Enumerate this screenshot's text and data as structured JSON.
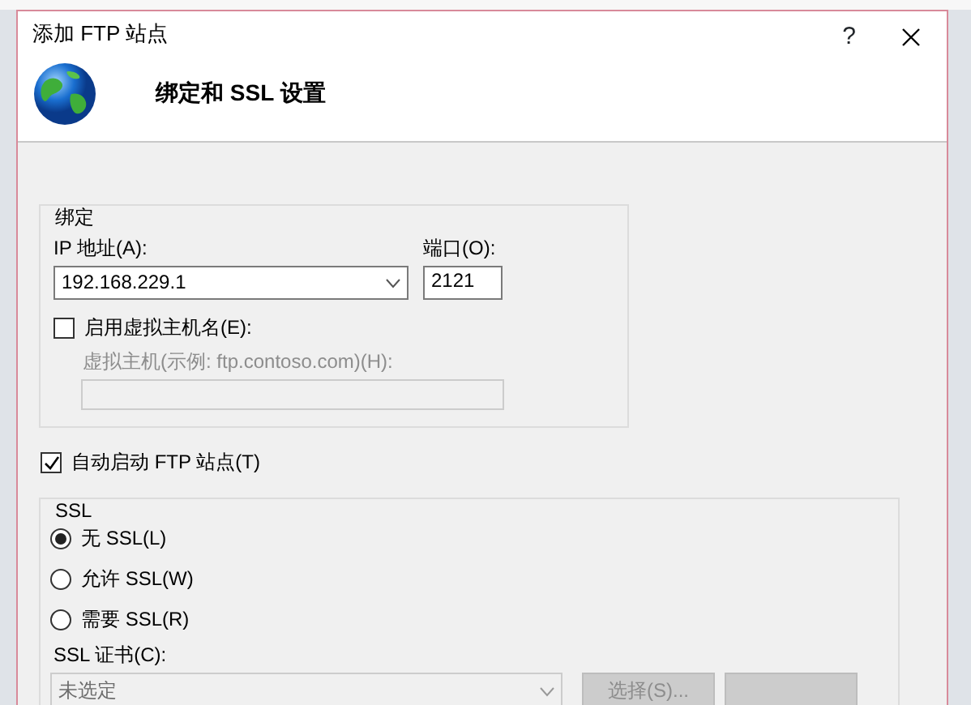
{
  "dialog": {
    "title": "添加 FTP 站点",
    "help": "?",
    "header": "绑定和 SSL 设置"
  },
  "binding": {
    "legend": "绑定",
    "ip_label": "IP 地址(A):",
    "ip_value": "192.168.229.1",
    "port_label": "端口(O):",
    "port_value": "2121",
    "virtual_host": {
      "label": "启用虚拟主机名(E):",
      "checked": false
    },
    "host_label": "虚拟主机(示例: ftp.contoso.com)(H):",
    "host_disabled": true
  },
  "auto_start": {
    "label": "自动启动 FTP 站点(T)",
    "checked": true
  },
  "ssl": {
    "legend": "SSL",
    "options": [
      {
        "label": "无 SSL(L)",
        "selected": true
      },
      {
        "label": "允许 SSL(W)",
        "selected": false
      },
      {
        "label": "需要 SSL(R)",
        "selected": false
      }
    ],
    "cert_label": "SSL 证书(C):",
    "cert_value": "未选定",
    "cert_disabled": true,
    "buttons": [
      {
        "label": "选择(S)...",
        "disabled": true
      },
      {
        "disabled": true
      }
    ]
  }
}
